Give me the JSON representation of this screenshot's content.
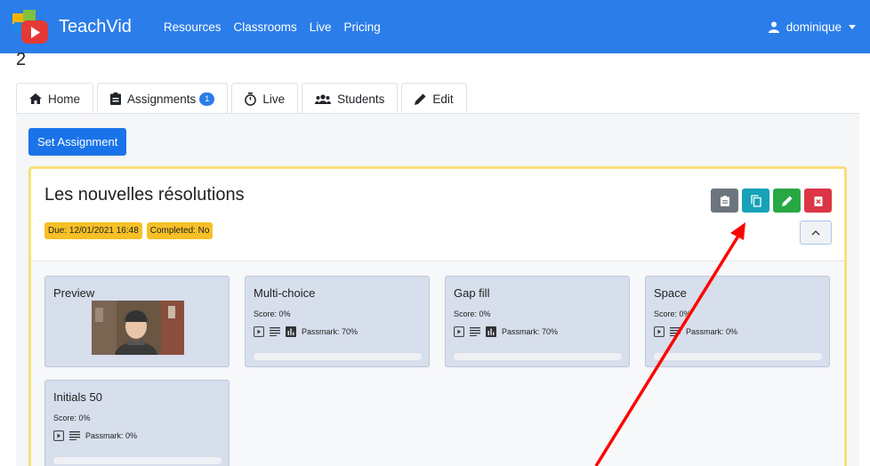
{
  "navbar": {
    "brand": "TeachVid",
    "links": [
      "Resources",
      "Classrooms",
      "Live",
      "Pricing"
    ],
    "user": "dominique"
  },
  "page_number": "2",
  "tabs": [
    {
      "label": "Home",
      "icon": "home-icon"
    },
    {
      "label": "Assignments",
      "icon": "clipboard-icon",
      "badge": "1"
    },
    {
      "label": "Live",
      "icon": "stopwatch-icon"
    },
    {
      "label": "Students",
      "icon": "users-icon"
    },
    {
      "label": "Edit",
      "icon": "pencil-icon"
    }
  ],
  "set_assignment_label": "Set Assignment",
  "assignment": {
    "title": "Les nouvelles résolutions",
    "due": "Due: 12/01/2021 16:48",
    "completed": "Completed: No",
    "actions": [
      "clipboard-icon",
      "copy-icon",
      "pencil-icon",
      "trash-icon"
    ]
  },
  "tiles": [
    {
      "title": "Preview"
    },
    {
      "title": "Multi-choice",
      "score": "Score: 0%",
      "passmark": "Passmark: 70%"
    },
    {
      "title": "Gap fill",
      "score": "Score: 0%",
      "passmark": "Passmark: 70%"
    },
    {
      "title": "Space",
      "score": "Score: 0%",
      "passmark": "Passmark: 0%"
    },
    {
      "title": "Initials 50",
      "score": "Score: 0%",
      "passmark": "Passmark: 0%"
    }
  ],
  "colors": {
    "navbar": "#2b7de9",
    "primary_button": "#1a73e8",
    "card_border": "#f9e07a",
    "badge": "#f6c026",
    "tile": "#d7deec",
    "arrow": "#ff0000"
  }
}
